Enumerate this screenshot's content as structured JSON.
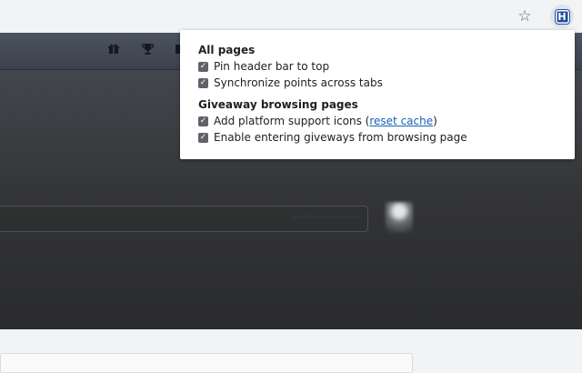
{
  "toolbar": {
    "bookmark_icon": "star-icon",
    "extension_icon": "extension-h-icon",
    "extension_letter": "H"
  },
  "site_header": {
    "icons": [
      "gift-icon",
      "trophy-icon",
      "inbox-icon"
    ]
  },
  "popup": {
    "sections": [
      {
        "title": "All pages",
        "options": [
          {
            "label": "Pin header bar to top",
            "checked": true
          },
          {
            "label": "Synchronize points across tabs",
            "checked": true
          }
        ]
      },
      {
        "title": "Giveaway browsing pages",
        "options": [
          {
            "label_before": "Add platform support icons (",
            "link": "reset cache",
            "label_after": ")",
            "checked": true
          },
          {
            "label": "Enable entering giveways from browsing page",
            "checked": true
          }
        ]
      }
    ]
  },
  "colors": {
    "link": "#1a5fb4",
    "checkbox": "#5f6368",
    "extension_logo": "#1f4fa0"
  }
}
